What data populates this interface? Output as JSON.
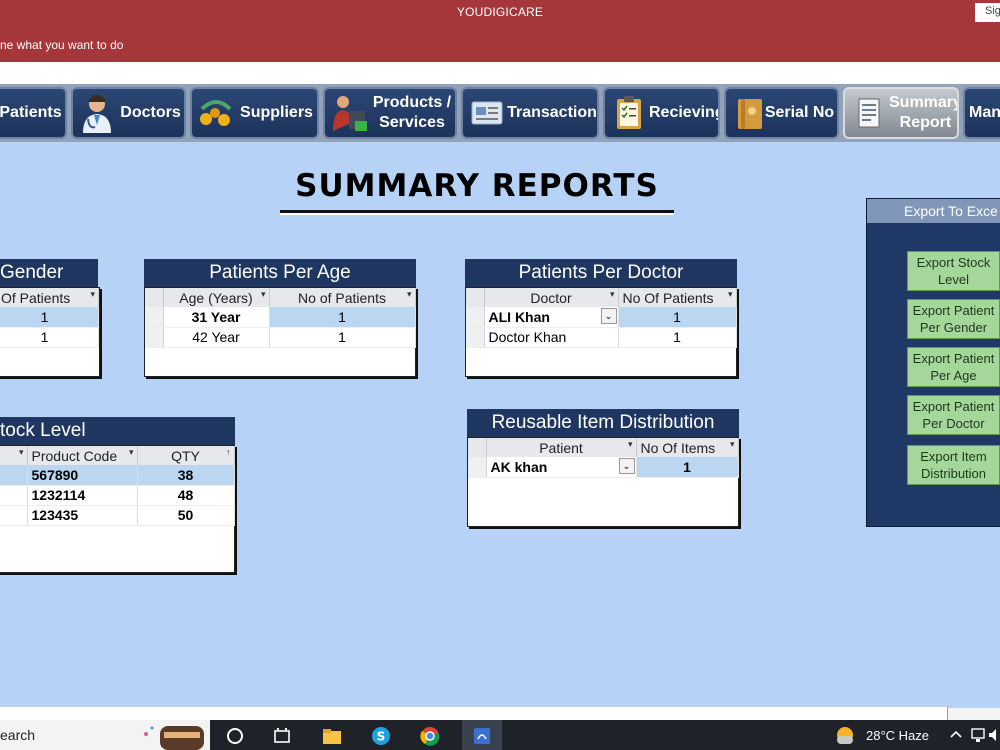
{
  "app": {
    "title": "YOUDIGICARE",
    "tell_me": "ne what you want to do",
    "signin": "Sig"
  },
  "nav": [
    {
      "label": "Patients",
      "icon": "patients-icon"
    },
    {
      "label": "Doctors",
      "icon": "doctor-icon"
    },
    {
      "label": "Suppliers",
      "icon": "suppliers-icon"
    },
    {
      "label": "Products / Services",
      "line1": "Products /",
      "line2": "Services",
      "icon": "products-icon"
    },
    {
      "label": "Transaction",
      "icon": "transaction-icon"
    },
    {
      "label": "Recieving",
      "icon": "clipboard-icon"
    },
    {
      "label": "Serial No",
      "icon": "folder-icon"
    },
    {
      "label": "Summary Report",
      "line1": "Summary",
      "line2": "Report",
      "icon": "report-icon",
      "active": true
    },
    {
      "label": "Man"
    }
  ],
  "page": {
    "title": "SUMMARY REPORTS"
  },
  "gender_card": {
    "title": "Gender",
    "columns": [
      "Of Patients"
    ],
    "rows": [
      [
        "1"
      ],
      [
        "1"
      ]
    ]
  },
  "age_card": {
    "title": "Patients Per Age",
    "columns": [
      "Age (Years)",
      "No of Patients"
    ],
    "rows": [
      [
        "31 Year",
        "1"
      ],
      [
        "42 Year",
        "1"
      ]
    ]
  },
  "doctor_card": {
    "title": "Patients Per Doctor",
    "columns": [
      "Doctor",
      "No Of Patients"
    ],
    "rows": [
      [
        "ALI Khan",
        "1"
      ],
      [
        "Doctor Khan",
        "1"
      ]
    ]
  },
  "stock_card": {
    "title": "tock Level",
    "columns": [
      "Product Code",
      "QTY"
    ],
    "rows": [
      [
        "567890",
        "38"
      ],
      [
        "1232114",
        "48"
      ],
      [
        "123435",
        "50"
      ]
    ]
  },
  "reusable_card": {
    "title": "Reusable Item Distribution",
    "columns": [
      "Patient",
      "No Of Items"
    ],
    "rows": [
      [
        "AK khan",
        "1"
      ]
    ]
  },
  "export": {
    "title": "Export To Exce",
    "buttons": [
      {
        "line1": "Export Stock",
        "line2": "Level"
      },
      {
        "line1": "Export Patient",
        "line2": "Per Gender"
      },
      {
        "line1": "Export Patient",
        "line2": "Per Age"
      },
      {
        "line1": "Export Patient",
        "line2": "Per Doctor"
      },
      {
        "line1": "Export Item",
        "line2": "Distribution"
      }
    ]
  },
  "taskbar": {
    "search": "earch",
    "weather": "28°C  Haze"
  },
  "colors": {
    "ribbon": "#a5373a",
    "nav_button": "#1e3660",
    "main_bg": "#b6d3f7",
    "highlight_row": "#bad6f1",
    "export_button": "#a6d79a"
  }
}
